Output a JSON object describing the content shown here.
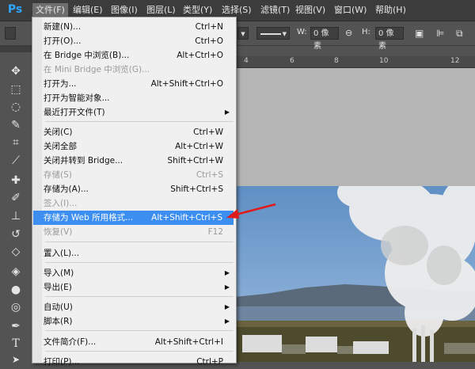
{
  "app": {
    "logo": "Ps"
  },
  "menubar": {
    "items": [
      "文件(F)",
      "编辑(E)",
      "图像(I)",
      "图层(L)",
      "类型(Y)",
      "选择(S)",
      "滤镜(T)",
      "视图(V)",
      "窗口(W)",
      "帮助(H)"
    ],
    "active_index": 0
  },
  "options": {
    "w_label": "W:",
    "w_value": "0 像素",
    "h_label": "H:",
    "h_value": "0 像素"
  },
  "ruler": {
    "ticks": [
      "4",
      "6",
      "8",
      "10",
      "12"
    ]
  },
  "file_menu": {
    "items": [
      {
        "label": "新建(N)...",
        "shortcut": "Ctrl+N",
        "disabled": false
      },
      {
        "label": "打开(O)...",
        "shortcut": "Ctrl+O",
        "disabled": false
      },
      {
        "label": "在 Bridge 中浏览(B)...",
        "shortcut": "Alt+Ctrl+O",
        "disabled": false
      },
      {
        "label": "在 Mini Bridge 中浏览(G)...",
        "shortcut": "",
        "disabled": true
      },
      {
        "label": "打开为...",
        "shortcut": "Alt+Shift+Ctrl+O",
        "disabled": false
      },
      {
        "label": "打开为智能对象...",
        "shortcut": "",
        "disabled": false
      },
      {
        "label": "最近打开文件(T)",
        "shortcut": "",
        "disabled": false,
        "submenu": true
      },
      {
        "label": "关闭(C)",
        "shortcut": "Ctrl+W",
        "disabled": false
      },
      {
        "label": "关闭全部",
        "shortcut": "Alt+Ctrl+W",
        "disabled": false
      },
      {
        "label": "关闭并转到 Bridge...",
        "shortcut": "Shift+Ctrl+W",
        "disabled": false
      },
      {
        "label": "存储(S)",
        "shortcut": "Ctrl+S",
        "disabled": true
      },
      {
        "label": "存储为(A)...",
        "shortcut": "Shift+Ctrl+S",
        "disabled": false
      },
      {
        "label": "签入(I)...",
        "shortcut": "",
        "disabled": true
      },
      {
        "label": "存储为 Web 所用格式...",
        "shortcut": "Alt+Shift+Ctrl+S",
        "disabled": false,
        "highlighted": true
      },
      {
        "label": "恢复(V)",
        "shortcut": "F12",
        "disabled": true
      },
      {
        "label": "置入(L)...",
        "shortcut": "",
        "disabled": false
      },
      {
        "label": "导入(M)",
        "shortcut": "",
        "disabled": false,
        "submenu": true
      },
      {
        "label": "导出(E)",
        "shortcut": "",
        "disabled": false,
        "submenu": true
      },
      {
        "label": "自动(U)",
        "shortcut": "",
        "disabled": false,
        "submenu": true
      },
      {
        "label": "脚本(R)",
        "shortcut": "",
        "disabled": false,
        "submenu": true
      },
      {
        "label": "文件简介(F)...",
        "shortcut": "Alt+Shift+Ctrl+I",
        "disabled": false
      },
      {
        "label": "打印(P)...",
        "shortcut": "Ctrl+P",
        "disabled": false
      }
    ],
    "submenu_arrow": "▶"
  },
  "colors": {
    "highlight": "#3c8ff0",
    "annotation_arrow": "#e01b1b"
  },
  "tools": {
    "icons": [
      "move-icon",
      "marquee-icon",
      "lasso-icon",
      "quick-select-icon",
      "crop-icon",
      "eyedropper-icon",
      "healing-brush-icon",
      "brush-icon",
      "clone-stamp-icon",
      "history-brush-icon",
      "eraser-icon",
      "paint-bucket-icon",
      "blur-icon",
      "dodge-icon",
      "pen-icon",
      "type-icon",
      "path-select-icon"
    ]
  }
}
